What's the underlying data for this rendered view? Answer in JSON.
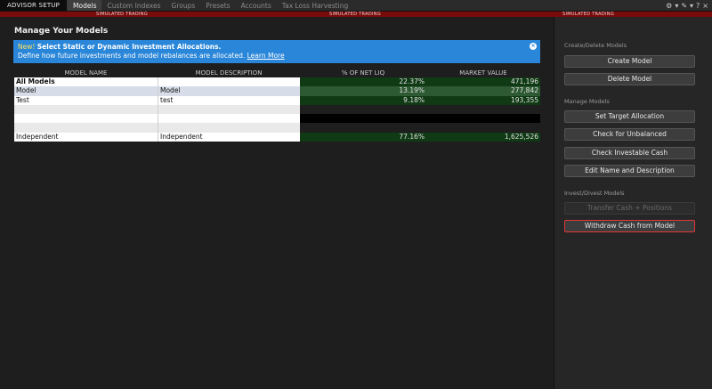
{
  "topbar": {
    "app_title": "ADVISOR SETUP",
    "tabs": [
      {
        "label": "Models",
        "active": true
      },
      {
        "label": "Custom Indexes",
        "active": false
      },
      {
        "label": "Groups",
        "active": false
      },
      {
        "label": "Presets",
        "active": false
      },
      {
        "label": "Accounts",
        "active": false
      },
      {
        "label": "Tax Loss Harvesting",
        "active": false
      }
    ],
    "icons": [
      "gear-icon",
      "chevron-down-icon",
      "pin-icon",
      "chevron-down-icon",
      "help-icon",
      "close-icon"
    ],
    "icon_glyphs": {
      "gear": "⚙",
      "pin": "✎",
      "chevron": "▾",
      "help": "?",
      "close": "×"
    }
  },
  "simbar": {
    "label": "SIMULATED TRADING",
    "color": "#7a0b0b"
  },
  "main": {
    "title": "Manage Your Models",
    "banner": {
      "new_tag": "New!",
      "headline": "Select Static or Dynamic Investment Allocations.",
      "body": "Define how future investments and model rebalances are allocated.",
      "link": "Learn More",
      "close_glyph": "×",
      "color": "#2a86d8"
    },
    "table": {
      "columns": [
        "MODEL NAME",
        "MODEL DESCRIPTION",
        "% OF NET LIQ",
        "MARKET VALUE"
      ],
      "rows": [
        {
          "name": "All Models",
          "description": "",
          "pct": "22.37%",
          "value": "471,196"
        },
        {
          "name": "Model",
          "description": "Model",
          "pct": "13.19%",
          "value": "277,842"
        },
        {
          "name": "Test",
          "description": "test",
          "pct": "9.18%",
          "value": "193,355"
        },
        {
          "name": "Independent",
          "description": "Independent",
          "pct": "77.16%",
          "value": "1,625,526"
        }
      ]
    }
  },
  "rightpanel": {
    "create_delete_label": "Create/Delete Models",
    "create_button": "Create Model",
    "delete_button": "Delete Model",
    "manage_label": "Manage Models",
    "set_target_button": "Set Target Allocation",
    "check_unbalanced_button": "Check for Unbalanced",
    "check_investable_button": "Check Investable Cash",
    "edit_name_button": "Edit Name and Description",
    "invest_divest_label": "Invest/Divest Models",
    "transfer_button": "Transfer Cash + Positions",
    "withdraw_button": "Withdraw Cash from Model",
    "highlight_color": "#e0383a"
  }
}
